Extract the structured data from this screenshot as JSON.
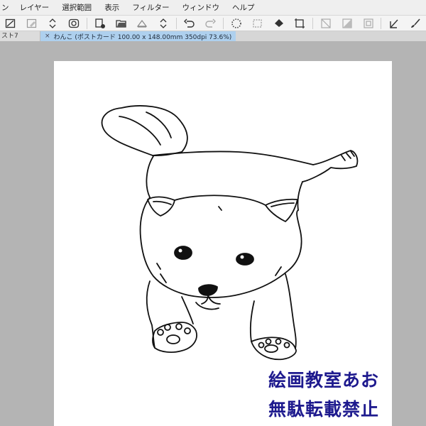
{
  "menubar": {
    "items": [
      {
        "label": "ン"
      },
      {
        "label": "レイヤー"
      },
      {
        "label": "選択範囲"
      },
      {
        "label": "表示"
      },
      {
        "label": "フィルター"
      },
      {
        "label": "ウィンドウ"
      },
      {
        "label": "ヘルプ"
      }
    ]
  },
  "toolbar": {
    "icons": [
      "transform-icon",
      "eraser-icon",
      "up-down-arrows-icon",
      "view-icon",
      "new-layer-icon",
      "open-folder-icon",
      "save-icon",
      "up-down-arrows-icon",
      "undo-icon",
      "redo-icon",
      "loading-spinner-icon",
      "select-icon",
      "fill-icon",
      "crop-icon",
      "slash-box-icon",
      "gradient-box-icon",
      "frame-box-icon",
      "line-tool-icon",
      "brush-tool-icon"
    ]
  },
  "tabs": {
    "previous": "スト7",
    "active": "わんこ (ポストカード 100.00 x 148.00mm 350dpi 73.6%)",
    "close_glyph": "×"
  },
  "watermark": {
    "line1": "絵画教室あお",
    "line2": "無駄転載禁止",
    "color": "#1e1a8e"
  },
  "colors": {
    "workspace": "#b4b4b4",
    "tab_active": "#aed0ee",
    "canvas": "#ffffff"
  }
}
